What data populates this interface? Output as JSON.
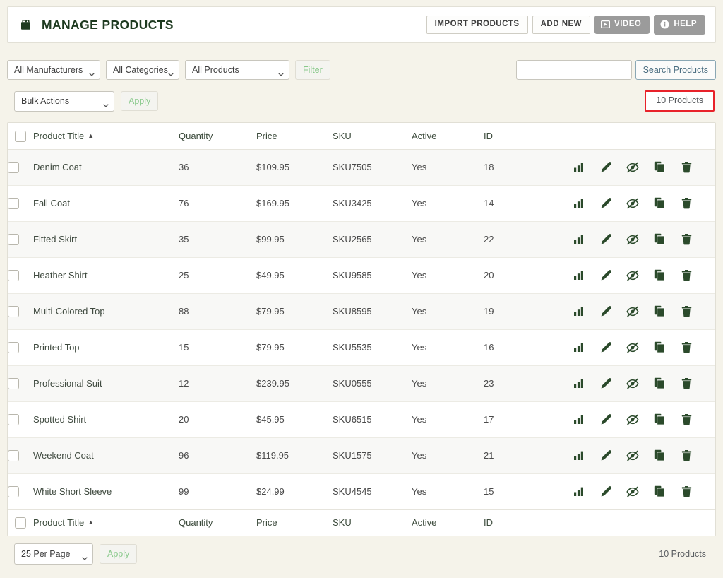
{
  "header": {
    "icon": "shopping-bag-icon",
    "title": "MANAGE PRODUCTS",
    "buttons": {
      "import": "IMPORT PRODUCTS",
      "add_new": "ADD NEW",
      "video": "VIDEO",
      "help": "HELP"
    }
  },
  "filters": {
    "manufacturer": "All Manufacturers",
    "category": "All Categories",
    "product_type": "All Products",
    "filter_button": "Filter",
    "search_value": "",
    "search_placeholder": "",
    "search_button": "Search Products"
  },
  "bulk": {
    "action": "Bulk Actions",
    "apply": "Apply",
    "count": "10 Products"
  },
  "table": {
    "columns": [
      "Product Title",
      "Quantity",
      "Price",
      "SKU",
      "Active",
      "ID"
    ],
    "sort_column": "Product Title",
    "sort_direction": "asc",
    "sort_caret": "▲",
    "row_action_icons": [
      "stats-icon",
      "edit-icon",
      "hide-icon",
      "duplicate-icon",
      "delete-icon"
    ],
    "rows": [
      {
        "title": "Denim Coat",
        "quantity": "36",
        "price": "$109.95",
        "sku": "SKU7505",
        "active": "Yes",
        "id": "18"
      },
      {
        "title": "Fall Coat",
        "quantity": "76",
        "price": "$169.95",
        "sku": "SKU3425",
        "active": "Yes",
        "id": "14"
      },
      {
        "title": "Fitted Skirt",
        "quantity": "35",
        "price": "$99.95",
        "sku": "SKU2565",
        "active": "Yes",
        "id": "22"
      },
      {
        "title": "Heather Shirt",
        "quantity": "25",
        "price": "$49.95",
        "sku": "SKU9585",
        "active": "Yes",
        "id": "20"
      },
      {
        "title": "Multi-Colored Top",
        "quantity": "88",
        "price": "$79.95",
        "sku": "SKU8595",
        "active": "Yes",
        "id": "19"
      },
      {
        "title": "Printed Top",
        "quantity": "15",
        "price": "$79.95",
        "sku": "SKU5535",
        "active": "Yes",
        "id": "16"
      },
      {
        "title": "Professional Suit",
        "quantity": "12",
        "price": "$239.95",
        "sku": "SKU0555",
        "active": "Yes",
        "id": "23"
      },
      {
        "title": "Spotted Shirt",
        "quantity": "20",
        "price": "$45.95",
        "sku": "SKU6515",
        "active": "Yes",
        "id": "17"
      },
      {
        "title": "Weekend Coat",
        "quantity": "96",
        "price": "$119.95",
        "sku": "SKU1575",
        "active": "Yes",
        "id": "21"
      },
      {
        "title": "White Short Sleeve",
        "quantity": "99",
        "price": "$24.99",
        "sku": "SKU4545",
        "active": "Yes",
        "id": "15"
      }
    ]
  },
  "footer": {
    "per_page": "25 Per Page",
    "apply": "Apply",
    "count": "10 Products"
  },
  "colors": {
    "page_background": "#f5f3ea",
    "panel": "#ffffff",
    "title_green": "#1e3a20",
    "icon_green": "#2b4a2b",
    "accent_red": "#e8222a",
    "ghost_green": "#89c98b",
    "search_blue": "#4a6d80",
    "gray_button": "#9b9b9b"
  }
}
